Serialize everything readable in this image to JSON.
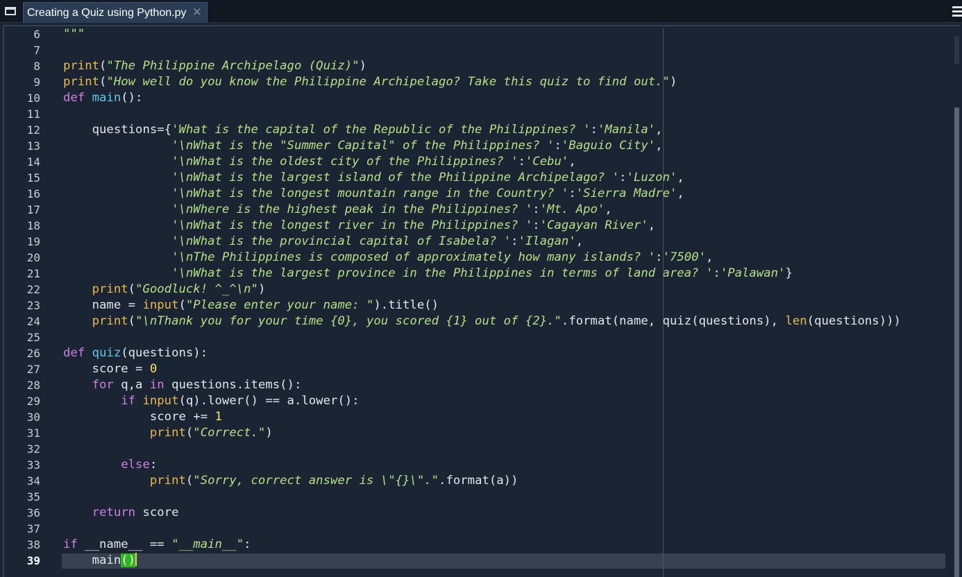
{
  "tab": {
    "title": "Creating a Quiz using Python.py",
    "close_glyph": "✕"
  },
  "editor": {
    "first_line_number": 6,
    "active_line": 39,
    "lines": [
      [
        [
          "s",
          "\"\"\""
        ]
      ],
      [],
      [
        [
          "b",
          "print"
        ],
        [
          "p",
          "("
        ],
        [
          "s",
          "\"The Philippine Archipelago (Quiz)\""
        ],
        [
          "p",
          ")"
        ]
      ],
      [
        [
          "b",
          "print"
        ],
        [
          "p",
          "("
        ],
        [
          "s",
          "\"How well do you know the Philippine Archipelago? Take this quiz to find out.\""
        ],
        [
          "p",
          ")"
        ]
      ],
      [
        [
          "k",
          "def"
        ],
        [
          "p",
          " "
        ],
        [
          "f",
          "main"
        ],
        [
          "p",
          "():"
        ]
      ],
      [],
      [
        [
          "p",
          "    questions={"
        ],
        [
          "s",
          "'What is the capital of the Republic of the Philippines? '"
        ],
        [
          "p",
          ":"
        ],
        [
          "s",
          "'Manila'"
        ],
        [
          "p",
          ","
        ]
      ],
      [
        [
          "p",
          "               "
        ],
        [
          "s",
          "'\\nWhat is the \"Summer Capital\" of the Philippines? '"
        ],
        [
          "p",
          ":"
        ],
        [
          "s",
          "'Baguio City'"
        ],
        [
          "p",
          ","
        ]
      ],
      [
        [
          "p",
          "               "
        ],
        [
          "s",
          "'\\nWhat is the oldest city of the Philippines? '"
        ],
        [
          "p",
          ":"
        ],
        [
          "s",
          "'Cebu'"
        ],
        [
          "p",
          ","
        ]
      ],
      [
        [
          "p",
          "               "
        ],
        [
          "s",
          "'\\nWhat is the largest island of the Philippine Archipelago? '"
        ],
        [
          "p",
          ":"
        ],
        [
          "s",
          "'Luzon'"
        ],
        [
          "p",
          ","
        ]
      ],
      [
        [
          "p",
          "               "
        ],
        [
          "s",
          "'\\nWhat is the longest mountain range in the Country? '"
        ],
        [
          "p",
          ":"
        ],
        [
          "s",
          "'Sierra Madre'"
        ],
        [
          "p",
          ","
        ]
      ],
      [
        [
          "p",
          "               "
        ],
        [
          "s",
          "'\\nWhere is the highest peak in the Philippines? '"
        ],
        [
          "p",
          ":"
        ],
        [
          "s",
          "'Mt. Apo'"
        ],
        [
          "p",
          ","
        ]
      ],
      [
        [
          "p",
          "               "
        ],
        [
          "s",
          "'\\nWhat is the longest river in the Philippines? '"
        ],
        [
          "p",
          ":"
        ],
        [
          "s",
          "'Cagayan River'"
        ],
        [
          "p",
          ","
        ]
      ],
      [
        [
          "p",
          "               "
        ],
        [
          "s",
          "'\\nWhat is the provincial capital of Isabela? '"
        ],
        [
          "p",
          ":"
        ],
        [
          "s",
          "'Ilagan'"
        ],
        [
          "p",
          ","
        ]
      ],
      [
        [
          "p",
          "               "
        ],
        [
          "s",
          "'\\nThe Philippines is composed of approximately how many islands? '"
        ],
        [
          "p",
          ":"
        ],
        [
          "s",
          "'7500'"
        ],
        [
          "p",
          ","
        ]
      ],
      [
        [
          "p",
          "               "
        ],
        [
          "s",
          "'\\nWhat is the largest province in the Philippines in terms of land area? '"
        ],
        [
          "p",
          ":"
        ],
        [
          "s",
          "'Palawan'"
        ],
        [
          "p",
          "}"
        ]
      ],
      [
        [
          "p",
          "    "
        ],
        [
          "b",
          "print"
        ],
        [
          "p",
          "("
        ],
        [
          "s",
          "\"Goodluck! ^_^\\n\""
        ],
        [
          "p",
          ")"
        ]
      ],
      [
        [
          "p",
          "    name = "
        ],
        [
          "b",
          "input"
        ],
        [
          "p",
          "("
        ],
        [
          "s",
          "\"Please enter your name: \""
        ],
        [
          "p",
          ").title()"
        ]
      ],
      [
        [
          "p",
          "    "
        ],
        [
          "b",
          "print"
        ],
        [
          "p",
          "("
        ],
        [
          "s",
          "\"\\nThank you for your time {0}, you scored {1} out of {2}.\""
        ],
        [
          "p",
          ".format(name, quiz(questions), "
        ],
        [
          "b",
          "len"
        ],
        [
          "p",
          "(questions)))"
        ]
      ],
      [],
      [
        [
          "k",
          "def"
        ],
        [
          "p",
          " "
        ],
        [
          "f",
          "quiz"
        ],
        [
          "p",
          "(questions):"
        ]
      ],
      [
        [
          "p",
          "    score = "
        ],
        [
          "n",
          "0"
        ]
      ],
      [
        [
          "p",
          "    "
        ],
        [
          "k",
          "for"
        ],
        [
          "p",
          " q,a "
        ],
        [
          "k",
          "in"
        ],
        [
          "p",
          " questions.items():"
        ]
      ],
      [
        [
          "p",
          "        "
        ],
        [
          "k",
          "if"
        ],
        [
          "p",
          " "
        ],
        [
          "b",
          "input"
        ],
        [
          "p",
          "(q).lower() == a.lower():"
        ]
      ],
      [
        [
          "p",
          "            score += "
        ],
        [
          "n",
          "1"
        ]
      ],
      [
        [
          "p",
          "            "
        ],
        [
          "b",
          "print"
        ],
        [
          "p",
          "("
        ],
        [
          "s",
          "\"Correct.\""
        ],
        [
          "p",
          ")"
        ]
      ],
      [],
      [
        [
          "p",
          "        "
        ],
        [
          "k",
          "else"
        ],
        [
          "p",
          ":"
        ]
      ],
      [
        [
          "p",
          "            "
        ],
        [
          "b",
          "print"
        ],
        [
          "p",
          "("
        ],
        [
          "s",
          "\"Sorry, correct answer is \\\"{}\\\".\""
        ],
        [
          "p",
          ".format(a))"
        ]
      ],
      [],
      [
        [
          "p",
          "    "
        ],
        [
          "k",
          "return"
        ],
        [
          "p",
          " score"
        ]
      ],
      [],
      [
        [
          "k",
          "if"
        ],
        [
          "p",
          " __name__ == "
        ],
        [
          "s",
          "\"__main__\""
        ],
        [
          "p",
          ":"
        ]
      ],
      [
        [
          "p",
          "    main"
        ],
        [
          "m",
          "()"
        ],
        [
          "c",
          ""
        ]
      ]
    ]
  },
  "colors": {
    "background": "#1b2432",
    "string": "#b6e087",
    "keyword": "#d17ee6",
    "builtin": "#eabb52",
    "function": "#66c7ea",
    "number": "#f6e66c",
    "bracket_match": "#2fb61f"
  },
  "icons": {
    "window": "window-icon",
    "close": "close-icon",
    "menu": "hamburger-menu-icon"
  }
}
